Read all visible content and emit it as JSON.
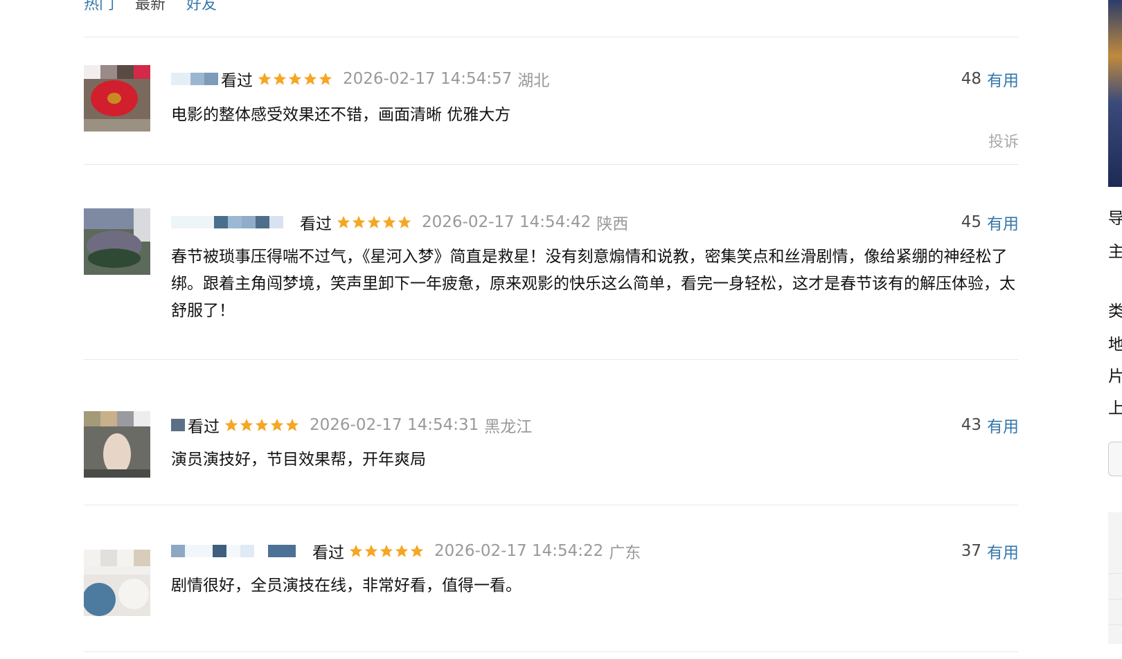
{
  "tabs": {
    "hot": "热门",
    "latest": "最新",
    "friends": "好友"
  },
  "comments": [
    {
      "status": "看过",
      "rating": 5,
      "time": "2026-02-17 14:54:57",
      "region": "湖北",
      "votes": "48",
      "useful_label": "有用",
      "content": "电影的整体感受效果还不错，画面清晰 优雅大方",
      "report_label": "投诉"
    },
    {
      "status": "看过",
      "rating": 5,
      "time": "2026-02-17 14:54:42",
      "region": "陕西",
      "votes": "45",
      "useful_label": "有用",
      "content": "春节被琐事压得喘不过气，《星河入梦》简直是救星！没有刻意煽情和说教，密集笑点和丝滑剧情，像给紧绷的神经松了绑。跟着主角闯梦境，笑声里卸下一年疲惫，原来观影的快乐这么简单，看完一身轻松，这才是春节该有的解压体验，太舒服了！"
    },
    {
      "status": "看过",
      "rating": 5,
      "time": "2026-02-17 14:54:31",
      "region": "黑龙江",
      "votes": "43",
      "useful_label": "有用",
      "content": "演员演技好，节目效果帮，开年爽局"
    },
    {
      "status": "看过",
      "rating": 5,
      "time": "2026-02-17 14:54:22",
      "region": "广东",
      "votes": "37",
      "useful_label": "有用",
      "content": "剧情很好，全员演技在线，非常好看，值得一看。"
    }
  ],
  "sidebar": {
    "chars": [
      "导",
      "主",
      "类",
      "地",
      "片",
      "上"
    ]
  },
  "colors": {
    "link": "#3377aa",
    "star": "#f5a623",
    "meta_gray": "#999999",
    "divider": "#e8e8e8"
  },
  "icons": {
    "rating": "star-icon"
  }
}
